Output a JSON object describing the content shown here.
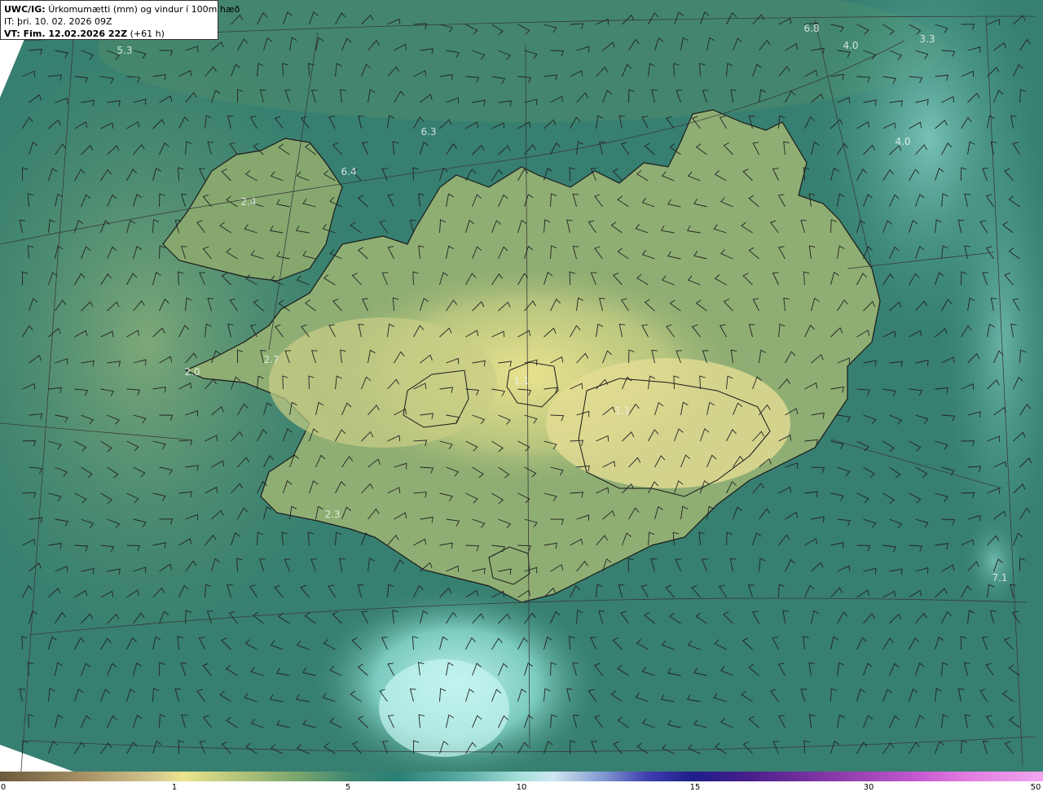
{
  "header": {
    "line1_bold": "UWC/IG:",
    "line1_text": "Úrkomumætti (mm) og vindur í 100m hæð",
    "line2": "IT: þri. 10. 02. 2026 09Z",
    "line3_bold": "VT: Fim. 12.02.2026 22Z",
    "line3_text": "(+61 h)"
  },
  "colors": {
    "ocean_deep": "#2e7a72",
    "ocean_mid": "#3f8872",
    "land_low": "#6f9e6a",
    "land_mid": "#b7c57f",
    "land_high": "#e2dc92",
    "bright_cyan": "#aeeae6",
    "coastline": "#1a1a1a",
    "grid_line": "#3a3a3a",
    "barb": "#222222"
  },
  "value_labels": [
    {
      "text": "5.3"
    },
    {
      "text": "6.8"
    },
    {
      "text": "4.0"
    },
    {
      "text": "6.3"
    },
    {
      "text": "6.4"
    },
    {
      "text": "4.0"
    },
    {
      "text": "2.4"
    },
    {
      "text": "2.7"
    },
    {
      "text": "2.0"
    },
    {
      "text": "1.1"
    },
    {
      "text": "1.1"
    },
    {
      "text": "2.3"
    },
    {
      "text": "7.1"
    },
    {
      "text": "3.3"
    }
  ],
  "colorbar": {
    "ticks": [
      "0",
      "1",
      "5",
      "10",
      "15",
      "30",
      "50"
    ]
  }
}
